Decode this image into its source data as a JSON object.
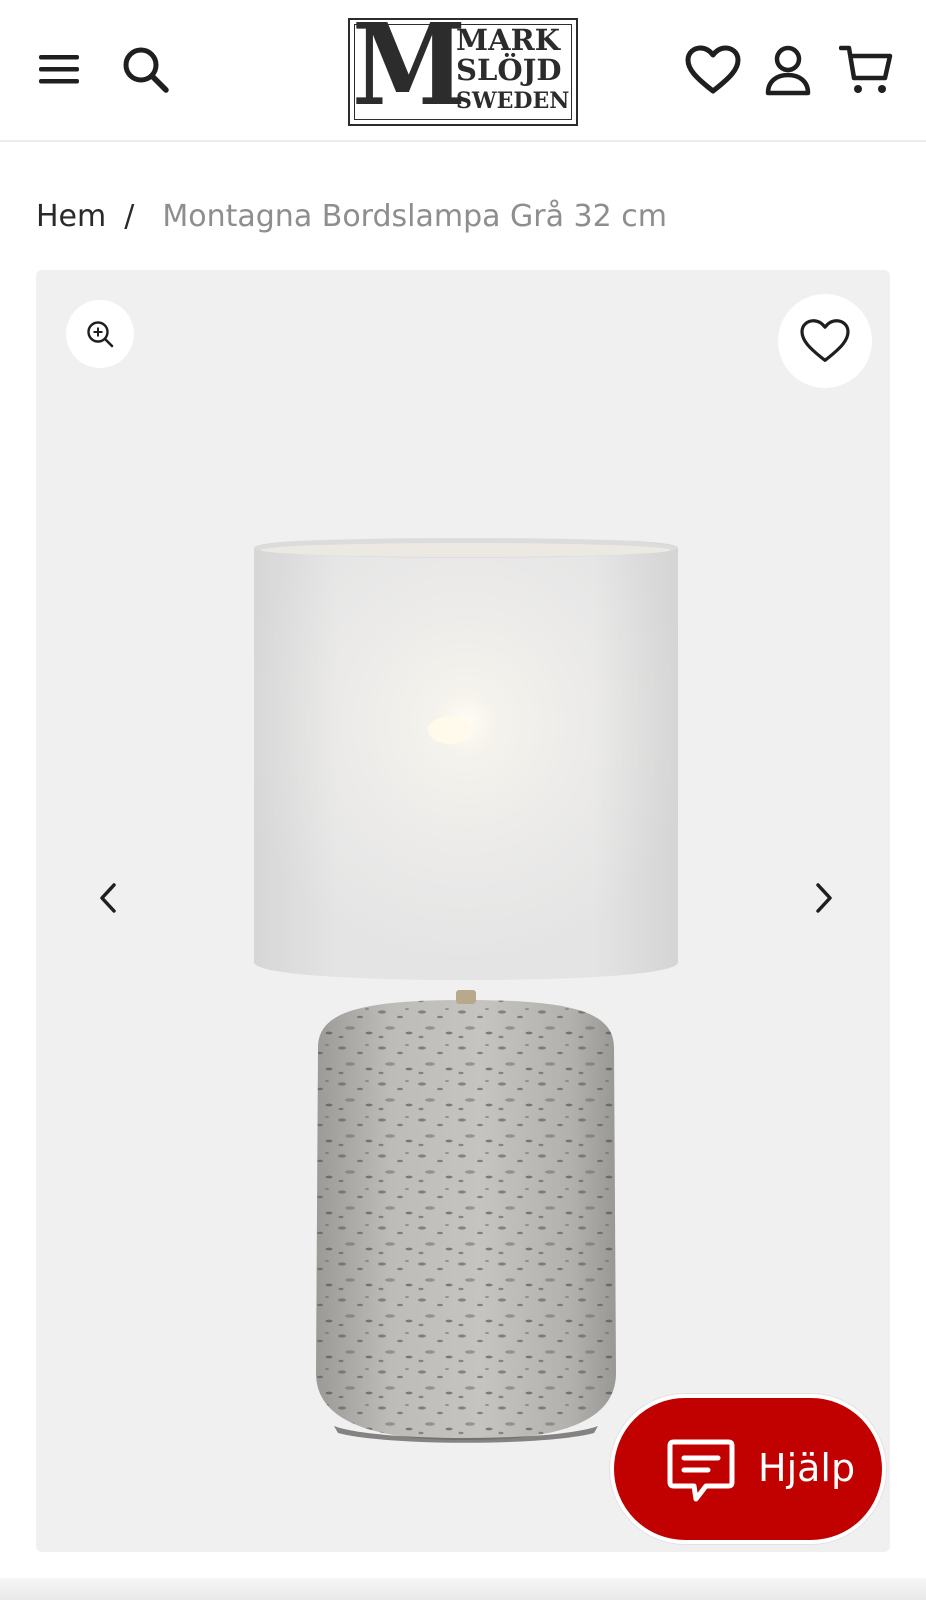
{
  "header": {
    "logo": {
      "letter": "M",
      "line1": "MARK",
      "line2": "SLÖJD",
      "line3": "SWEDEN"
    },
    "icons": {
      "menu": "menu-icon",
      "search": "search-icon",
      "wishlist": "heart-icon",
      "account": "user-icon",
      "cart": "cart-icon"
    }
  },
  "breadcrumb": {
    "home": "Hem",
    "separator": "/",
    "current": "Montagna Bordslampa Grå 32 cm"
  },
  "gallery": {
    "icons": {
      "zoom": "zoom-in-icon",
      "favorite": "heart-icon",
      "prev": "chevron-left-icon",
      "next": "chevron-right-icon"
    },
    "image": "table-lamp-product-photo"
  },
  "help": {
    "label": "Hjälp",
    "icon": "chat-icon"
  },
  "colors": {
    "accent": "#c10000",
    "text": "#2a2a2a",
    "muted": "#8e8e8e",
    "gallery_bg": "#f0f0f0"
  }
}
